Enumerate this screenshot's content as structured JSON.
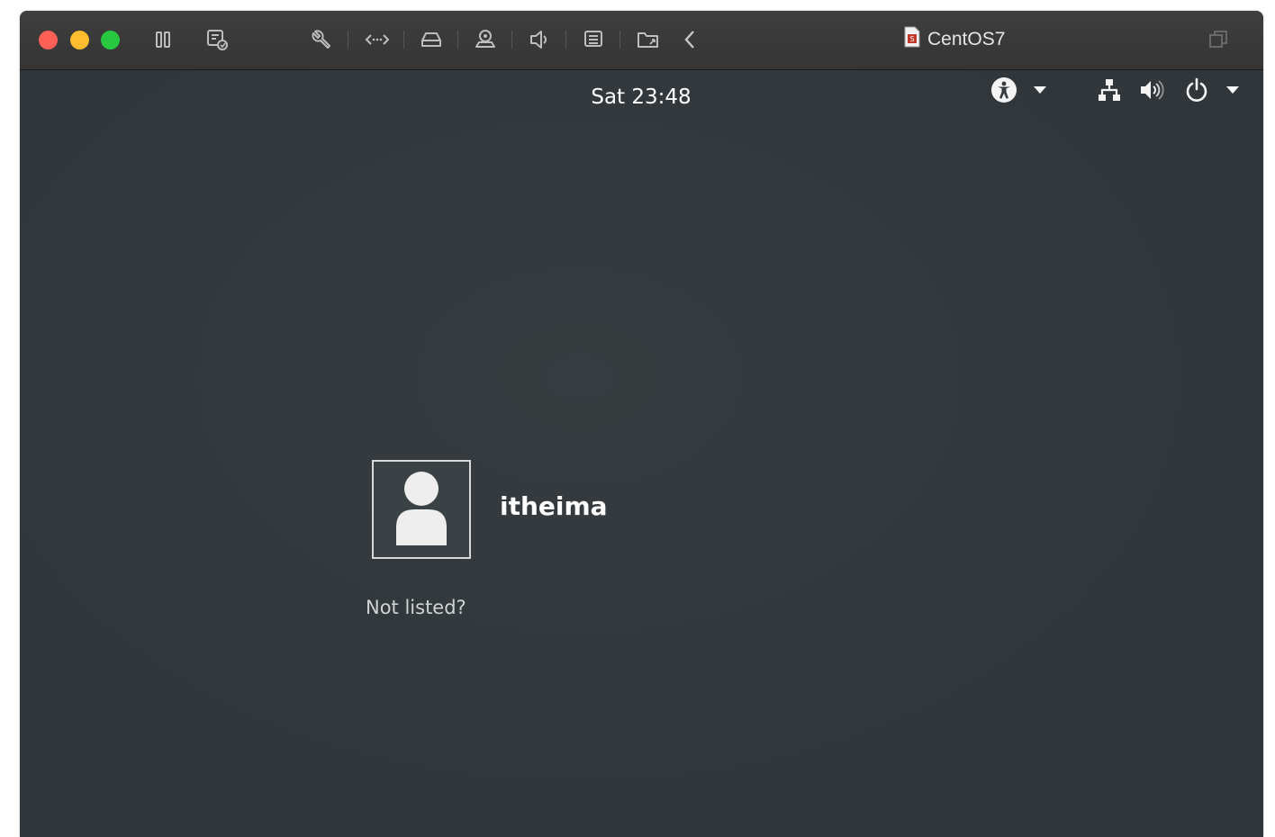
{
  "window": {
    "title": "CentOS7",
    "traffic_lights": {
      "close": "#fe5f57",
      "minimize": "#febc2e",
      "zoom": "#28c840"
    },
    "toolbar_icons": [
      "pause-icon",
      "snapshot-icon",
      "wrench-icon",
      "network-arrows-icon",
      "hard-disk-icon",
      "camera-icon",
      "sound-icon",
      "printer-icon",
      "shared-folder-icon",
      "chevron-left-icon"
    ],
    "right_icon": "restore-window-icon"
  },
  "top_bar": {
    "clock": "Sat 23:48",
    "icons": [
      "accessibility-icon",
      "dropdown-arrow-icon",
      "network-icon",
      "volume-icon",
      "power-icon",
      "dropdown-arrow-icon"
    ]
  },
  "login": {
    "users": [
      {
        "name": "itheima",
        "avatar": "default-user-icon"
      }
    ],
    "not_listed": "Not listed?"
  }
}
